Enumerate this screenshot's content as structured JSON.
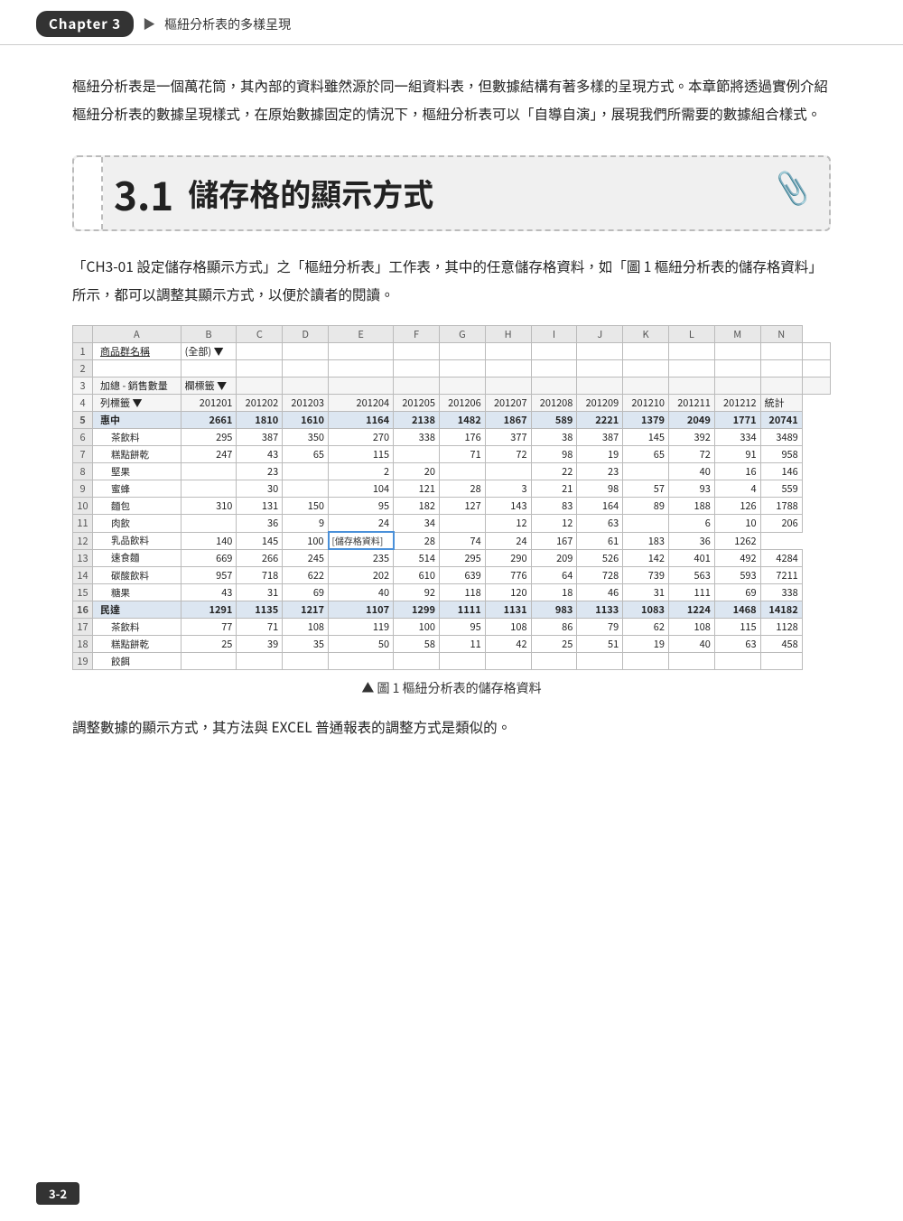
{
  "header": {
    "chapter_badge": "Chapter 3",
    "arrow": "▶",
    "subtitle": "樞紐分析表的多樣呈現"
  },
  "intro": {
    "text": "樞紐分析表是一個萬花筒，其內部的資料雖然源於同一組資料表，但數據結構有著多樣的呈現方式。本章節將透過實例介紹樞紐分析表的數據呈現樣式，在原始數據固定的情況下，樞紐分析表可以「自導自演」，展現我們所需要的數據組合樣式。"
  },
  "section": {
    "number": "3.1",
    "title": "儲存格的顯示方式"
  },
  "body_text": "「CH3-01 設定儲存格顯示方式」之「樞紐分析表」工作表，其中的任意儲存格資料，如「圖 1 樞紐分析表的儲存格資料」所示，都可以調整其顯示方式，以便於讀者的閱讀。",
  "figure_caption": "圖 1 樞紐分析表的儲存格資料",
  "adjust_text": "調整數據的顯示方式，其方法與 EXCEL 普通報表的調整方式是類似的。",
  "excel": {
    "col_headers": [
      "",
      "A",
      "B",
      "C",
      "D",
      "E",
      "F",
      "G",
      "H",
      "I",
      "J",
      "K",
      "L",
      "M",
      "N"
    ],
    "rows": [
      {
        "row": "1",
        "cells": [
          "商品群名稱",
          "(全部) ▼",
          "",
          "",
          "",
          "",
          "",
          "",
          "",
          "",
          "",
          "",
          "",
          "",
          ""
        ]
      },
      {
        "row": "2",
        "cells": [
          "",
          "",
          "",
          "",
          "",
          "",
          "",
          "",
          "",
          "",
          "",
          "",
          "",
          "",
          ""
        ]
      },
      {
        "row": "3",
        "cells": [
          "加總 - 銷售數量",
          "欄標籤 ▼",
          "",
          "",
          "",
          "",
          "",
          "",
          "",
          "",
          "",
          "",
          "",
          "",
          ""
        ]
      },
      {
        "row": "4",
        "cells": [
          "列標籤 ▼",
          "201201",
          "201202",
          "201203",
          "201204",
          "201205",
          "201206",
          "201207",
          "201208",
          "201209",
          "201210",
          "201211",
          "201212",
          "統計"
        ]
      },
      {
        "row": "5",
        "cells": [
          "惠中",
          "2661",
          "1810",
          "1610",
          "1164",
          "2138",
          "1482",
          "1867",
          "589",
          "2221",
          "1379",
          "2049",
          "1771",
          "20741"
        ],
        "bold": true
      },
      {
        "row": "6",
        "cells": [
          "茶飲料",
          "295",
          "387",
          "350",
          "270",
          "338",
          "176",
          "377",
          "38",
          "387",
          "145",
          "392",
          "334",
          "3489"
        ]
      },
      {
        "row": "7",
        "cells": [
          "糕點餅乾",
          "247",
          "43",
          "65",
          "115",
          "",
          "71",
          "72",
          "98",
          "19",
          "65",
          "72",
          "91",
          "958"
        ]
      },
      {
        "row": "8",
        "cells": [
          "堅果",
          "",
          "23",
          "",
          "2",
          "20",
          "",
          "",
          "22",
          "23",
          "",
          "40",
          "16",
          "146"
        ]
      },
      {
        "row": "9",
        "cells": [
          "蜜蜂",
          "",
          "30",
          "",
          "104",
          "121",
          "28",
          "3",
          "21",
          "98",
          "57",
          "93",
          "4",
          "559"
        ]
      },
      {
        "row": "10",
        "cells": [
          "麵包",
          "310",
          "131",
          "150",
          "95",
          "182",
          "127",
          "143",
          "83",
          "164",
          "89",
          "188",
          "126",
          "1788"
        ]
      },
      {
        "row": "11",
        "cells": [
          "肉飲",
          "",
          "36",
          "9",
          "24",
          "34",
          "",
          "12",
          "12",
          "63",
          "",
          "6",
          "10",
          "206"
        ]
      },
      {
        "row": "12",
        "cells": [
          "乳品飲料",
          "140",
          "145",
          "100",
          "[儲存格資料]",
          "28",
          "74",
          "24",
          "167",
          "61",
          "183",
          "36",
          "1262"
        ],
        "highlight": 4
      },
      {
        "row": "13",
        "cells": [
          "速食麵",
          "669",
          "266",
          "245",
          "235",
          "514",
          "295",
          "290",
          "209",
          "526",
          "142",
          "401",
          "492",
          "4284"
        ]
      },
      {
        "row": "14",
        "cells": [
          "碳酸飲料",
          "957",
          "718",
          "622",
          "202",
          "610",
          "639",
          "776",
          "64",
          "728",
          "739",
          "563",
          "593",
          "7211"
        ]
      },
      {
        "row": "15",
        "cells": [
          "糖果",
          "43",
          "31",
          "69",
          "40",
          "92",
          "118",
          "120",
          "18",
          "46",
          "31",
          "111",
          "69",
          "338"
        ]
      },
      {
        "row": "16",
        "cells": [
          "民達",
          "1291",
          "1135",
          "1217",
          "1107",
          "1299",
          "1111",
          "1131",
          "983",
          "1133",
          "1083",
          "1224",
          "1468",
          "14182"
        ],
        "bold": true
      },
      {
        "row": "17",
        "cells": [
          "茶飲料",
          "77",
          "71",
          "108",
          "119",
          "100",
          "95",
          "108",
          "86",
          "79",
          "62",
          "108",
          "115",
          "1128"
        ]
      },
      {
        "row": "18",
        "cells": [
          "糕點餅乾",
          "25",
          "39",
          "35",
          "50",
          "58",
          "11",
          "42",
          "25",
          "51",
          "19",
          "40",
          "63",
          "458"
        ]
      },
      {
        "row": "19",
        "cells": [
          "餃餌",
          "",
          "",
          "",
          "",
          "",
          "",
          "",
          "",
          "",
          "",
          "",
          "",
          ""
        ]
      }
    ]
  },
  "page_number": "3-2"
}
